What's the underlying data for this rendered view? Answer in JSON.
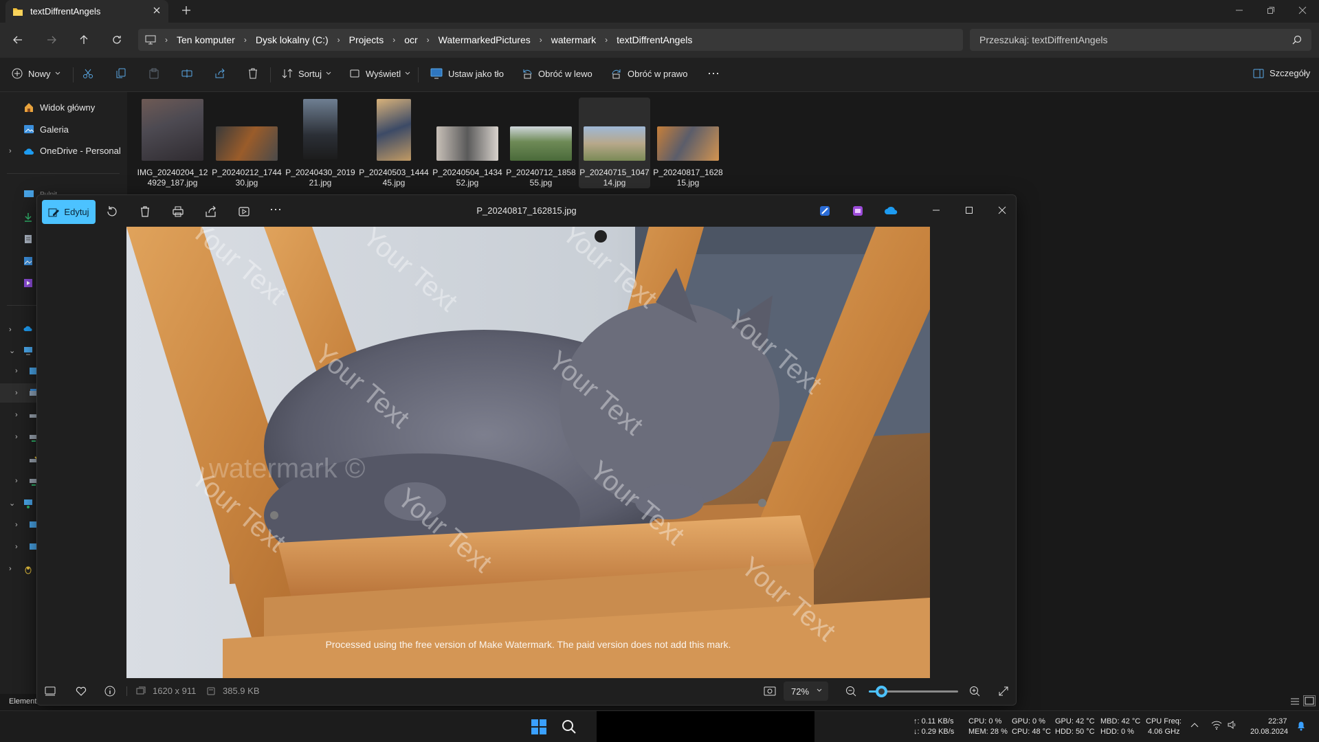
{
  "tab": {
    "title": "textDiffrentAngels"
  },
  "address": {
    "crumbs": [
      "Ten komputer",
      "Dysk lokalny (C:)",
      "Projects",
      "ocr",
      "WatermarkedPictures",
      "watermark",
      "textDiffrentAngels"
    ],
    "search_placeholder": "Przeszukaj: textDiffrentAngels"
  },
  "commandbar": {
    "new": "Nowy",
    "sort": "Sortuj",
    "view": "Wyświetl",
    "set_background": "Ustaw jako tło",
    "rotate_left": "Obróć w lewo",
    "rotate_right": "Obróć w prawo",
    "details": "Szczegóły"
  },
  "sidebar": {
    "home": "Widok główny",
    "gallery": "Galeria",
    "onedrive": "OneDrive - Personal",
    "truncated_item": "Pulpit",
    "status_left": "Element"
  },
  "files": [
    {
      "line1": "IMG_20240204_12",
      "line2": "4929_187.jpg"
    },
    {
      "line1": "P_20240212_1744",
      "line2": "30.jpg"
    },
    {
      "line1": "P_20240430_2019",
      "line2": "21.jpg"
    },
    {
      "line1": "P_20240503_1444",
      "line2": "45.jpg"
    },
    {
      "line1": "P_20240504_1434",
      "line2": "52.jpg"
    },
    {
      "line1": "P_20240712_1858",
      "line2": "55.jpg"
    },
    {
      "line1": "P_20240715_1047",
      "line2": "14.jpg"
    },
    {
      "line1": "P_20240817_1628",
      "line2": "15.jpg"
    }
  ],
  "viewer": {
    "edit_label": "Edytuj",
    "title": "P_20240817_162815.jpg",
    "dimensions": "1620 x 911",
    "filesize": "385.9 KB",
    "zoom": "72%",
    "zoom_fraction": 0.14,
    "watermark_text": "Your Text",
    "watermark_center": "watermark ©",
    "notice": "Processed using the free version of Make Watermark. The paid version does not add this mark."
  },
  "taskbar": {
    "net_up": "↑: 0.11 KB/s",
    "net_down": "↓: 0.29 KB/s",
    "cpu": "CPU: 0 %",
    "mem": "MEM: 28 %",
    "gpu": "GPU: 0 %",
    "cpu_temp": "CPU: 48 °C",
    "gpu_temp": "GPU: 42 °C",
    "hdd_temp": "HDD: 50 °C",
    "mbd": "MBD: 42 °C",
    "hdd": "HDD: 0 %",
    "cpu_freq_label": "CPU Freq:",
    "cpu_freq": "4.06 GHz",
    "time": "22:37",
    "date": "20.08.2024"
  },
  "colors": {
    "accent": "#4cc2ff",
    "folder": "#f3c13a"
  }
}
